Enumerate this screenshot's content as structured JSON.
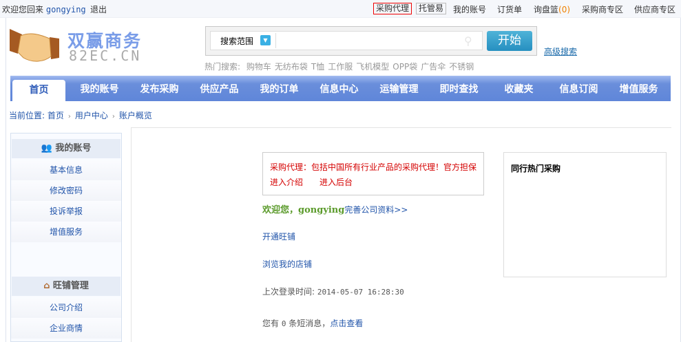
{
  "topbar": {
    "welcome": "欢迎您回来",
    "username": "gongying",
    "logout": "退出",
    "links": [
      "采购代理",
      "托管易",
      "我的账号",
      "订货单",
      "询盘篮",
      "采购商专区",
      "供应商专区"
    ],
    "inquiry_count": "(0)"
  },
  "logo": {
    "cn": "双赢商务",
    "en": "82EC.CN"
  },
  "search": {
    "scope": "搜索范围",
    "value": "",
    "button": "开始",
    "advanced": "高级搜索",
    "hot_label": "热门搜索:",
    "hot": [
      "购物车",
      "无纺布袋",
      "T恤",
      "工作服",
      "飞机模型",
      "OPP袋",
      "广告伞",
      "不锈钢"
    ]
  },
  "nav": [
    "首页",
    "我的账号",
    "发布采购",
    "供应产品",
    "我的订单",
    "信息中心",
    "运输管理",
    "即时查找",
    "收藏夹",
    "信息订阅",
    "增值服务"
  ],
  "breadcrumb": {
    "label": "当前位置:",
    "items": [
      "首页",
      "用户中心",
      "账户概览"
    ]
  },
  "sidebar": {
    "sections": [
      {
        "title": "我的账号",
        "icon": "users-icon",
        "items": [
          "基本信息",
          "修改密码",
          "投诉举报",
          "增值服务"
        ]
      },
      {
        "title": "旺铺管理",
        "icon": "house-icon",
        "items": [
          "公司介绍",
          "企业商情"
        ]
      }
    ]
  },
  "main": {
    "promo": {
      "text": "采购代理：包括中国所有行业产品的采购代理！官方担保",
      "link1": "进入介绍",
      "link2": "进入后台"
    },
    "welcome": "欢迎您，",
    "username": "gongying",
    "complete": "完善公司资料>>",
    "open_shop": "开通旺铺",
    "browse_shop": "浏览我的店铺",
    "last_login_label": "上次登录时间:",
    "last_login": "2014-05-07 16:28:30",
    "msg_prefix": "您有",
    "msg_count": "0",
    "msg_suffix": "条短消息，",
    "msg_link": "点击查看",
    "hot_title": "同行热门采购"
  }
}
